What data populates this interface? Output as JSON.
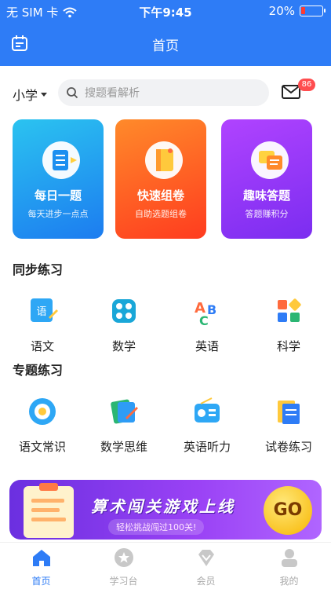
{
  "status": {
    "carrier": "无 SIM 卡",
    "time": "下午9:45",
    "battery": "20%",
    "battery_level": 0.2
  },
  "navbar": {
    "title": "首页"
  },
  "search": {
    "grade": "小学",
    "placeholder": "搜题看解析",
    "badge": "86"
  },
  "cards": [
    {
      "title": "每日一题",
      "subtitle": "每天进步一点点"
    },
    {
      "title": "快速组卷",
      "subtitle": "自助选题组卷"
    },
    {
      "title": "趣味答题",
      "subtitle": "答题赚积分"
    }
  ],
  "sync": {
    "title": "同步练习",
    "items": [
      "语文",
      "数学",
      "英语",
      "科学"
    ]
  },
  "topic": {
    "title": "专题练习",
    "items": [
      "语文常识",
      "数学思维",
      "英语听力",
      "试卷练习"
    ]
  },
  "banner": {
    "title": "算术闯关游戏上线",
    "subtitle": "轻松挑战闯过100关!",
    "go": "GO"
  },
  "tabs": [
    "首页",
    "学习台",
    "会员",
    "我的"
  ],
  "colors": {
    "primary": "#2e7cf6",
    "badge": "#ff4d4f"
  }
}
